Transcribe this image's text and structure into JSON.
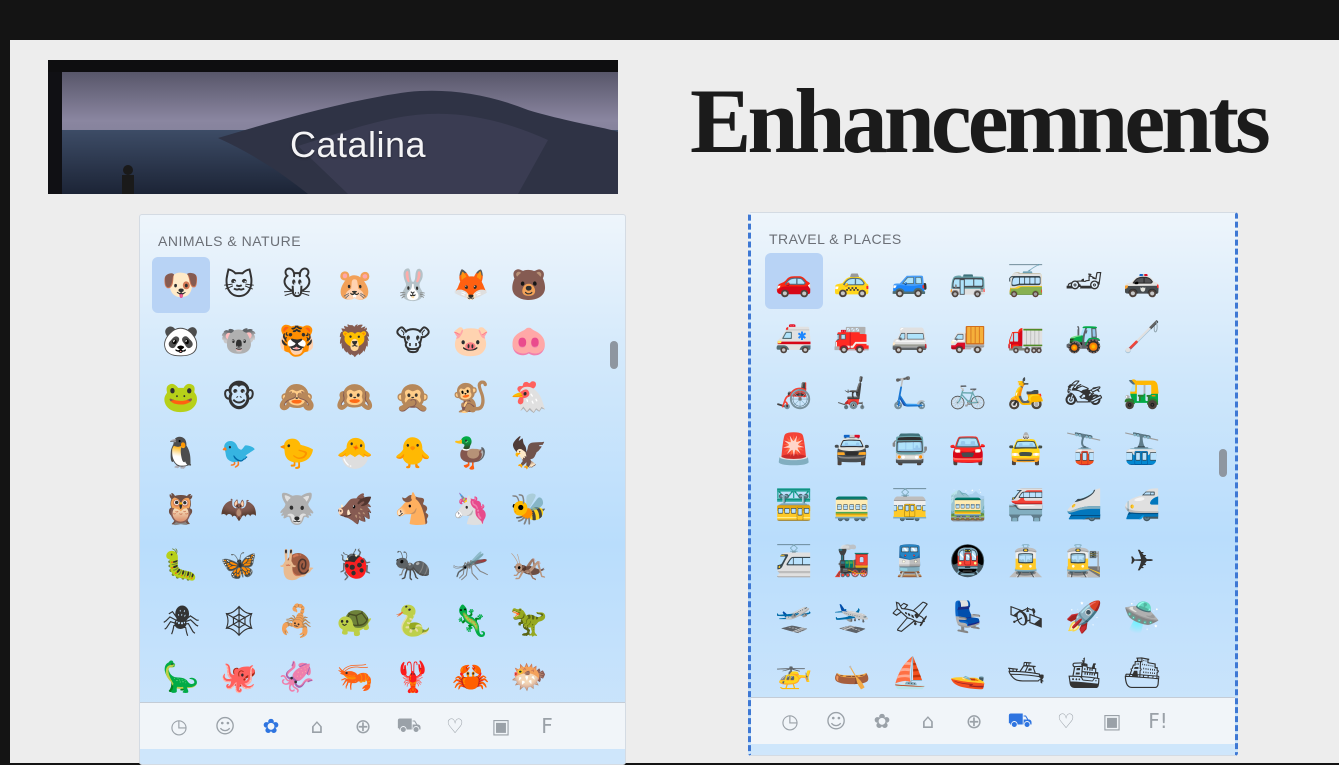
{
  "hero": {
    "title": "Catalina"
  },
  "heading": "Enhancemnents",
  "left_panel": {
    "section_title": "ANIMALS & NATURE",
    "emojis": [
      "🐶",
      "🐱",
      "🐭",
      "🐹",
      "🐰",
      "🦊",
      "🐻",
      "🐼",
      "🐨",
      "🐯",
      "🦁",
      "🐮",
      "🐷",
      "🐽",
      "🐸",
      "🐵",
      "🙈",
      "🙉",
      "🙊",
      "🐒",
      "🐔",
      "🐧",
      "🐦",
      "🐤",
      "🐣",
      "🐥",
      "🦆",
      "🦅",
      "🦉",
      "🦇",
      "🐺",
      "🐗",
      "🐴",
      "🦄",
      "🐝",
      "🐛",
      "🦋",
      "🐌",
      "🐞",
      "🐜",
      "🦟",
      "🦗",
      "🕷",
      "🕸",
      "🦂",
      "🐢",
      "🐍",
      "🦎",
      "🦖",
      "🦕",
      "🐙",
      "🦑",
      "🦐",
      "🦞",
      "🦀",
      "🐡"
    ],
    "categories": [
      "◷",
      "☺",
      "✿",
      "⌂",
      "⊕",
      "⛟",
      "♡",
      "▣",
      "F"
    ],
    "active_category": 2
  },
  "right_panel": {
    "section_title": "TRAVEL & PLACES",
    "emojis": [
      "🚗",
      "🚕",
      "🚙",
      "🚌",
      "🚎",
      "🏎",
      "🚓",
      "🚑",
      "🚒",
      "🚐",
      "🚚",
      "🚛",
      "🚜",
      "🦯",
      "🦽",
      "🦼",
      "🛴",
      "🚲",
      "🛵",
      "🏍",
      "🛺",
      "🚨",
      "🚔",
      "🚍",
      "🚘",
      "🚖",
      "🚡",
      "🚠",
      "🚟",
      "🚃",
      "🚋",
      "🚞",
      "🚝",
      "🚄",
      "🚅",
      "🚈",
      "🚂",
      "🚆",
      "🚇",
      "🚊",
      "🚉",
      "✈",
      "🛫",
      "🛬",
      "🛩",
      "💺",
      "🛰",
      "🚀",
      "🛸",
      "🚁",
      "🛶",
      "⛵",
      "🚤",
      "🛥",
      "🛳",
      "⛴"
    ],
    "categories": [
      "◷",
      "☺",
      "✿",
      "⌂",
      "⊕",
      "⛟",
      "♡",
      "▣",
      "F!"
    ],
    "active_category": 5
  }
}
